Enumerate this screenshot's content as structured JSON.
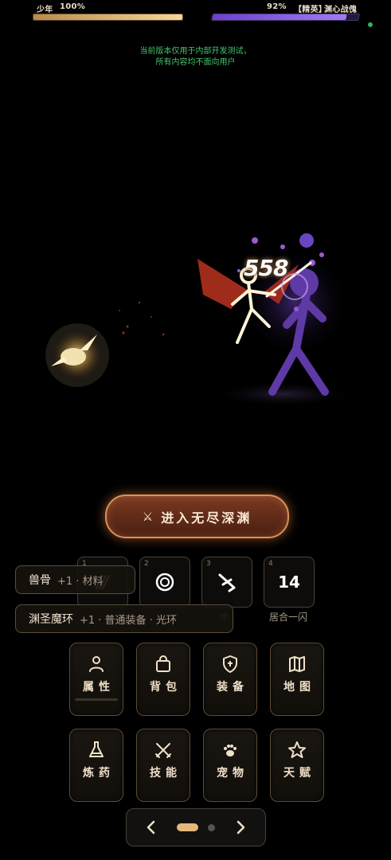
{
  "player": {
    "name": "少年",
    "hp_text": "100%",
    "hp_fraction": 1.0
  },
  "enemy": {
    "hp_text": "92%",
    "rank": "【精英】",
    "name": "渊心战傀",
    "hp_fraction": 0.92
  },
  "notice": {
    "line1": "当前版本仅用于内部开发测试，",
    "line2": "所有内容均不面向用户"
  },
  "battle": {
    "damage": "558"
  },
  "abyss_button": {
    "icon": "crossed-swords-icon",
    "label": "进入无尽深渊"
  },
  "skills": [
    {
      "slot": "1",
      "name": "",
      "icon": "claw-icon"
    },
    {
      "slot": "2",
      "name": "",
      "icon": "spiral-icon"
    },
    {
      "slot": "3",
      "name": "术",
      "icon": "dash-icon"
    },
    {
      "slot": "4",
      "name": "居合一闪",
      "cooldown": "14",
      "icon": "slash-icon"
    }
  ],
  "toasts": [
    {
      "item": "兽骨",
      "detail": "+1 · 材料"
    },
    {
      "item": "渊圣魔环",
      "detail": "+1 · 普通装备 · 光环"
    }
  ],
  "menu": {
    "row1": [
      {
        "label": "属性",
        "icon": "person-icon"
      },
      {
        "label": "背包",
        "icon": "bag-icon"
      },
      {
        "label": "装备",
        "icon": "shield-icon"
      },
      {
        "label": "地图",
        "icon": "map-icon"
      }
    ],
    "row2": [
      {
        "label": "炼药",
        "icon": "flask-icon"
      },
      {
        "label": "技能",
        "icon": "swords-icon"
      },
      {
        "label": "宠物",
        "icon": "paw-icon"
      },
      {
        "label": "天赋",
        "icon": "star-icon"
      }
    ]
  },
  "pager": {
    "current_page": 1,
    "total_pages": 2
  },
  "colors": {
    "accent": "#e6b77a",
    "player_hp": "#f6d79a",
    "enemy_hp": "#a27cf0",
    "notice": "#46c46c",
    "button_border": "#d9925a"
  }
}
